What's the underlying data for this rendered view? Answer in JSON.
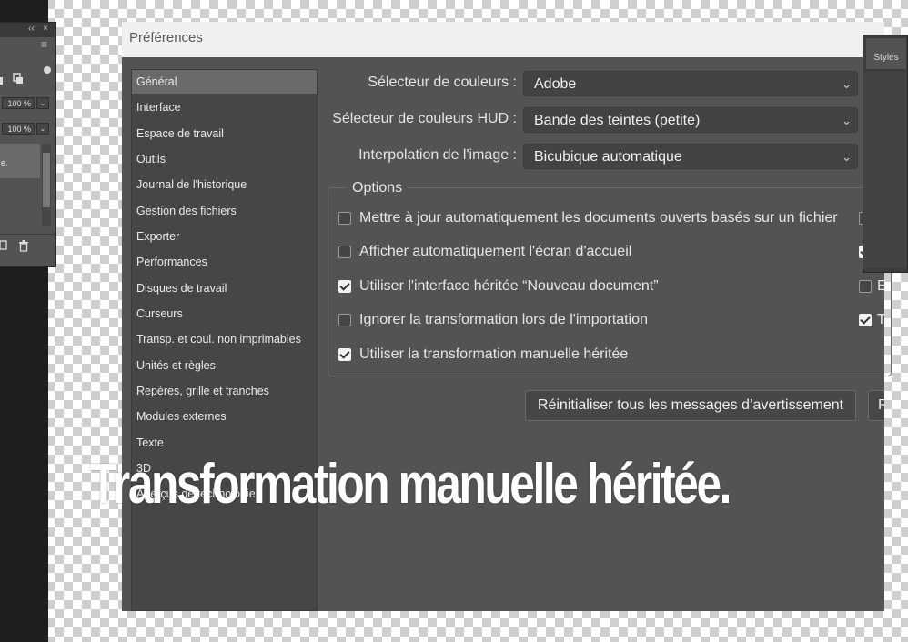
{
  "left_panel": {
    "top_icons": [
      "‹‹",
      "×",
      "≡"
    ],
    "tool_icons": [
      "lock-icon",
      "pin-icon"
    ],
    "opacity_value": "100 %",
    "fill_value": "100 %",
    "layer_text": "e.",
    "bottom_icons": [
      "new-layer-icon",
      "trash-icon"
    ]
  },
  "dialog": {
    "title": "Préférences",
    "nav": [
      "Général",
      "Interface",
      "Espace de travail",
      "Outils",
      "Journal de l'historique",
      "Gestion des fichiers",
      "Exporter",
      "Performances",
      "Disques de travail",
      "Curseurs",
      "Transp. et coul. non imprimables",
      "Unités et règles",
      "Repères, grille et tranches",
      "Modules externes",
      "Texte",
      "3D",
      "Aperçus de technologie"
    ],
    "selected_nav": "Général",
    "fields": [
      {
        "label": "Sélecteur de couleurs :",
        "value": "Adobe"
      },
      {
        "label": "Sélecteur de couleurs HUD :",
        "value": "Bande des teintes (petite)"
      },
      {
        "label": "Interpolation de l'image :",
        "value": "Bicubique automatique"
      }
    ],
    "options_title": "Options",
    "options": [
      {
        "label": "Mettre à jour automatiquement les documents ouverts basés sur un fichier",
        "checked": false
      },
      {
        "label": "Afficher automatiquement l'écran d'accueil",
        "checked": false
      },
      {
        "label": "Utiliser l'interface héritée “Nouveau document”",
        "checked": true
      },
      {
        "label": "Ignorer la transformation lors de l'importation",
        "checked": false
      },
      {
        "label": "Utiliser la transformation manuelle héritée",
        "checked": true
      }
    ],
    "right_checkboxes": [
      false,
      true,
      false,
      true
    ],
    "right_partial_labels": [
      "",
      "",
      "E",
      "T"
    ],
    "reset_button": "Réinitialiser tous les messages d’avertissement",
    "partial_button": "R"
  },
  "right_panel": {
    "tab": "Styles"
  },
  "caption": "Transformation manuelle héritée."
}
